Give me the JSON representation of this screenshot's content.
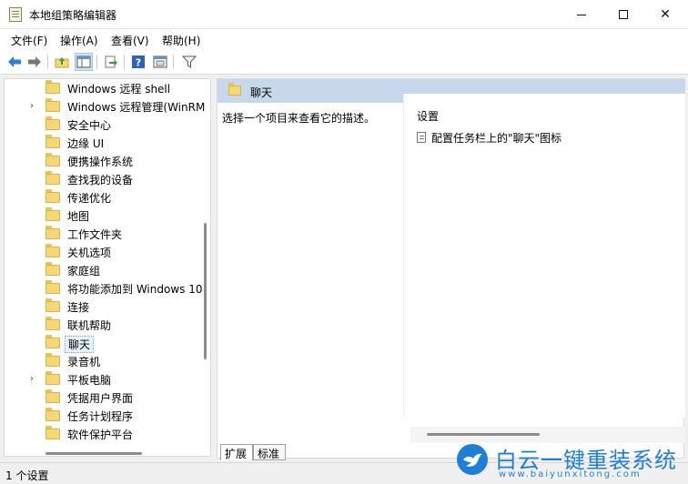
{
  "window": {
    "title": "本地组策略编辑器",
    "controls": {
      "minimize": "minimize-icon",
      "maximize": "maximize-icon",
      "close": "✕"
    }
  },
  "menu": [
    "文件(F)",
    "操作(A)",
    "查看(V)",
    "帮助(H)"
  ],
  "toolbar": [
    "back-arrow-icon",
    "forward-arrow-icon",
    "up-folder-icon",
    "show-hide-tree-icon",
    "export-list-icon",
    "help-icon",
    "properties-icon",
    "filter-icon"
  ],
  "tree": {
    "items": [
      {
        "label": "Windows 远程 shell",
        "expandable": false
      },
      {
        "label": "Windows 远程管理(WinRM",
        "expandable": true
      },
      {
        "label": "安全中心",
        "expandable": false
      },
      {
        "label": "边缘 UI",
        "expandable": false
      },
      {
        "label": "便携操作系统",
        "expandable": false
      },
      {
        "label": "查找我的设备",
        "expandable": false
      },
      {
        "label": "传递优化",
        "expandable": false
      },
      {
        "label": "地图",
        "expandable": false
      },
      {
        "label": "工作文件夹",
        "expandable": false
      },
      {
        "label": "关机选项",
        "expandable": false
      },
      {
        "label": "家庭组",
        "expandable": false
      },
      {
        "label": "将功能添加到 Windows 10",
        "expandable": false
      },
      {
        "label": "连接",
        "expandable": false
      },
      {
        "label": "联机帮助",
        "expandable": false
      },
      {
        "label": "聊天",
        "expandable": false,
        "selected": true
      },
      {
        "label": "录音机",
        "expandable": false
      },
      {
        "label": "平板电脑",
        "expandable": true
      },
      {
        "label": "凭据用户界面",
        "expandable": false
      },
      {
        "label": "任务计划程序",
        "expandable": false
      },
      {
        "label": "软件保护平台",
        "expandable": false
      }
    ]
  },
  "details": {
    "header": "聊天",
    "description": "选择一个项目来查看它的描述。",
    "settings_header": "设置",
    "settings": [
      "配置任务栏上的\"聊天\"图标"
    ]
  },
  "tabs": [
    "扩展",
    "标准"
  ],
  "status": "1 个设置",
  "watermark": {
    "title": "白云一键重装系统",
    "url": "www.baiyunxitong.com"
  },
  "colors": {
    "header_bg": "#c7d8ec",
    "folder": "#f6d776",
    "accent": "#1f7fd6"
  }
}
